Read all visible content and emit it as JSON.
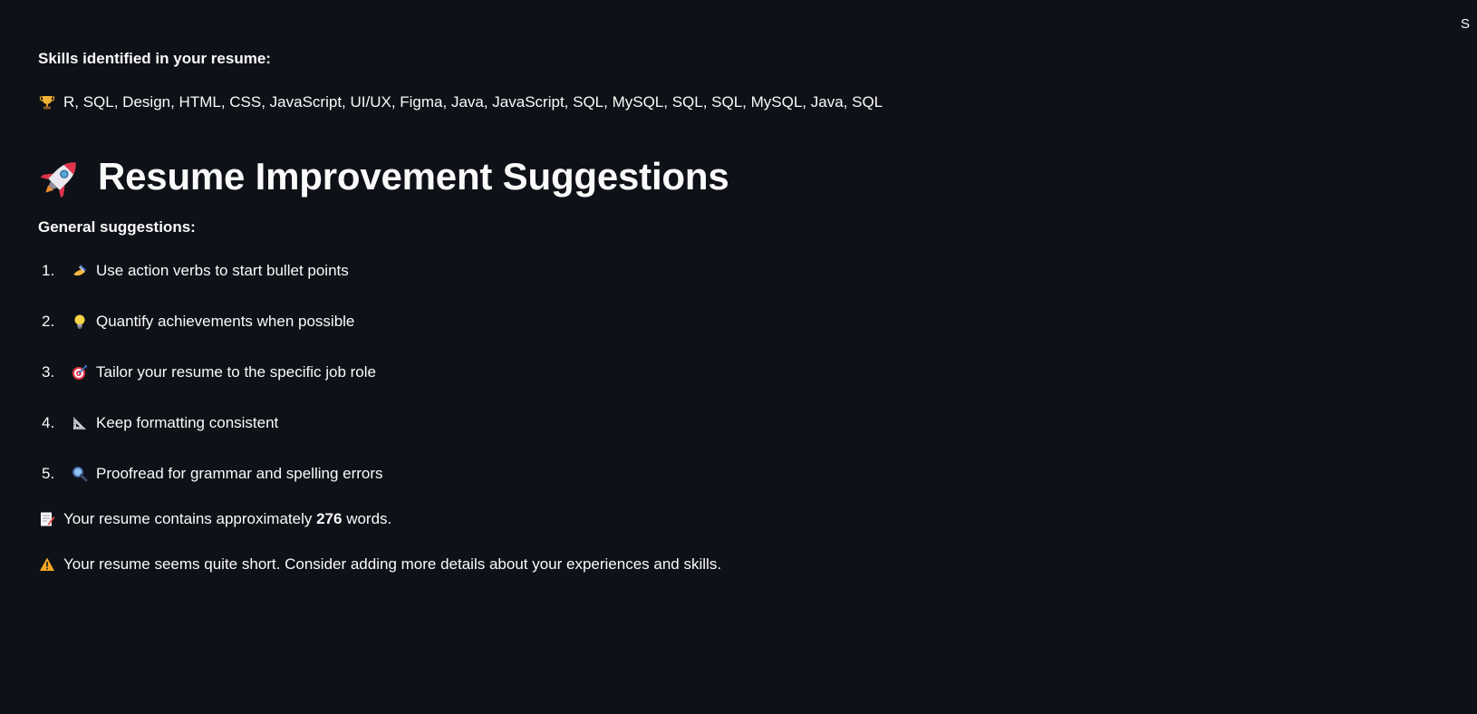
{
  "corner_text": "S",
  "skills": {
    "label": "Skills identified in your resume:",
    "icon": "trophy-icon",
    "text": "R, SQL, Design, HTML, CSS, JavaScript, UI/UX, Figma, Java, JavaScript, SQL, MySQL, SQL, SQL, MySQL, Java, SQL"
  },
  "heading": {
    "icon": "rocket-icon",
    "title": "Resume Improvement Suggestions"
  },
  "general": {
    "label": "General suggestions:",
    "items": [
      {
        "number": "1.",
        "icon": "writing-hand-icon",
        "text": "Use action verbs to start bullet points"
      },
      {
        "number": "2.",
        "icon": "light-bulb-icon",
        "text": "Quantify achievements when possible"
      },
      {
        "number": "3.",
        "icon": "target-icon",
        "text": "Tailor your resume to the specific job role"
      },
      {
        "number": "4.",
        "icon": "triangular-ruler-icon",
        "text": "Keep formatting consistent"
      },
      {
        "number": "5.",
        "icon": "magnifying-glass-icon",
        "text": "Proofread for grammar and spelling errors"
      }
    ]
  },
  "word_count": {
    "icon": "memo-icon",
    "prefix": "Your resume contains approximately",
    "count": "276",
    "suffix": "words."
  },
  "warning": {
    "icon": "warning-icon",
    "text": "Your resume seems quite short. Consider adding more details about your experiences and skills."
  }
}
